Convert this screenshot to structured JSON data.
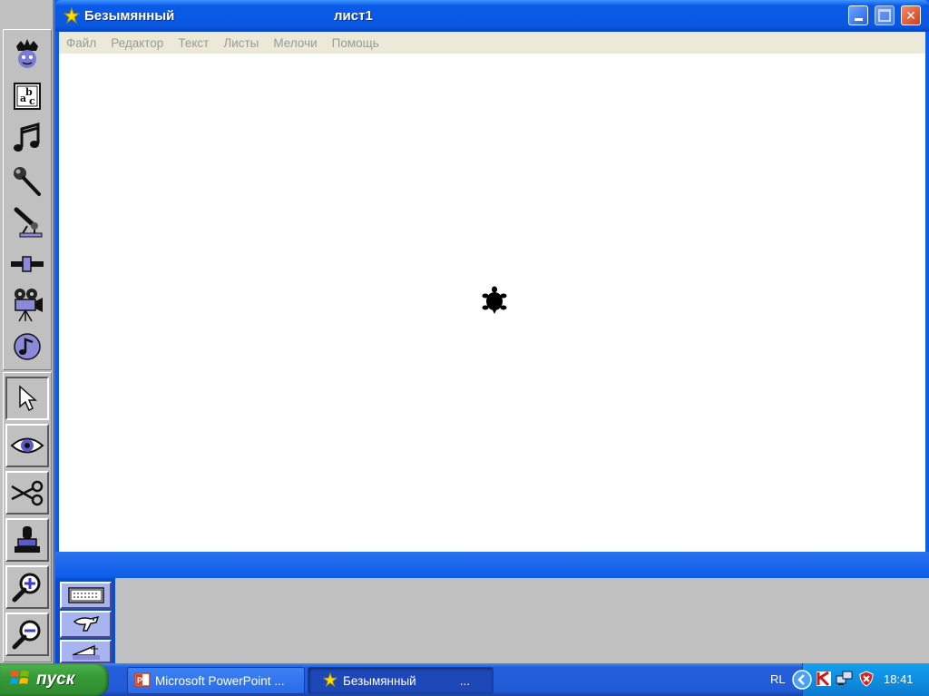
{
  "window": {
    "title": "Безымянный",
    "sheet_name": "лист1",
    "buttons": {
      "minimize": "minimize",
      "maximize": "maximize",
      "close": "✕"
    }
  },
  "menu": {
    "items": [
      "Файл",
      "Редактор",
      "Текст",
      "Листы",
      "Мелочи",
      "Помощь"
    ]
  },
  "left_toolbar": {
    "tools": [
      {
        "name": "turtle-new",
        "icon": "turtle-face-icon"
      },
      {
        "name": "text-box",
        "icon": "text-abc-icon"
      },
      {
        "name": "melody",
        "icon": "music-note-icon"
      },
      {
        "name": "sound-recorder",
        "icon": "microphone-icon"
      },
      {
        "name": "magnet",
        "icon": "telescope-icon"
      },
      {
        "name": "slider",
        "icon": "slider-icon"
      },
      {
        "name": "video",
        "icon": "film-camera-icon"
      },
      {
        "name": "cd-music",
        "icon": "cd-note-icon"
      },
      {
        "name": "pointer",
        "icon": "arrow-pointer-icon",
        "selected": true
      },
      {
        "name": "eye",
        "icon": "eye-icon"
      },
      {
        "name": "scissors",
        "icon": "scissors-icon"
      },
      {
        "name": "stamp",
        "icon": "stamp-icon"
      },
      {
        "name": "zoom-in",
        "icon": "magnifier-plus-icon"
      },
      {
        "name": "zoom-out",
        "icon": "magnifier-minus-icon"
      }
    ]
  },
  "bottom_tools": [
    {
      "icon": "keyboard-icon"
    },
    {
      "icon": "dog-icon"
    },
    {
      "icon": "boat-icon"
    }
  ],
  "taskbar": {
    "start_label": "пуск",
    "tasks": [
      {
        "label": "Microsoft PowerPoint ...",
        "icon": "powerpoint-icon",
        "active": false
      },
      {
        "label": "Безымянный",
        "suffix": "...",
        "icon": "star-icon",
        "active": true
      }
    ],
    "tray": {
      "language": "RL",
      "clock": "18:41"
    }
  },
  "colors": {
    "title_blue": "#0a5ae8",
    "canvas_white": "#ffffff",
    "panel_gray": "#c0c0c0",
    "start_green": "#379a37"
  }
}
